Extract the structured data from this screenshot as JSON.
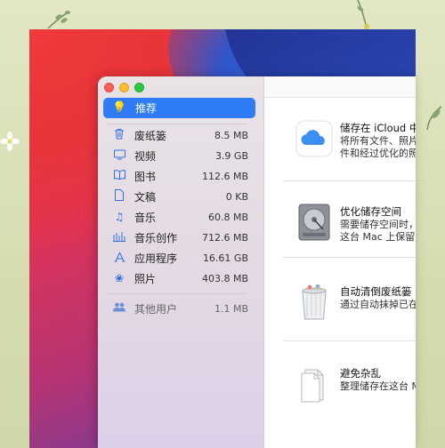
{
  "sidebar": {
    "recommended": {
      "label": "推荐",
      "icon": "lightbulb-icon"
    },
    "items": [
      {
        "label": "废纸篓",
        "size": "8.5 MB",
        "icon": "trash-icon"
      },
      {
        "label": "视频",
        "size": "3.9 GB",
        "icon": "tv-icon"
      },
      {
        "label": "图书",
        "size": "112.6 MB",
        "icon": "book-icon"
      },
      {
        "label": "文稿",
        "size": "0 KB",
        "icon": "document-icon"
      },
      {
        "label": "音乐",
        "size": "60.8 MB",
        "icon": "music-note-icon"
      },
      {
        "label": "音乐创作",
        "size": "712.6 MB",
        "icon": "music-creation-icon"
      },
      {
        "label": "应用程序",
        "size": "16.61 GB",
        "icon": "app-store-icon"
      },
      {
        "label": "照片",
        "size": "403.8 MB",
        "icon": "photos-flower-icon"
      }
    ],
    "other_users": {
      "label": "其他用户",
      "size": "1.1 MB",
      "icon": "users-icon"
    }
  },
  "recommendations": [
    {
      "title": "储存在 iCloud 中",
      "desc_lines": [
        "将所有文件、照片",
        "件和经过优化的照"
      ],
      "icon": "icloud-icon"
    },
    {
      "title": "优化储存空间",
      "desc_lines": [
        "需要储存空间时，",
        "这台 Mac 上保留最"
      ],
      "icon": "hard-drive-icon"
    },
    {
      "title": "自动清倒废纸篓",
      "desc_lines": [
        "通过自动抹掉已在"
      ],
      "icon": "trash-full-icon"
    },
    {
      "title": "避免杂乱",
      "desc_lines": [
        "整理储存在这台 M"
      ],
      "icon": "documents-icon"
    }
  ],
  "colors": {
    "accent": "#2f7cf6",
    "sidebar_icon": "#2f6fe0"
  }
}
